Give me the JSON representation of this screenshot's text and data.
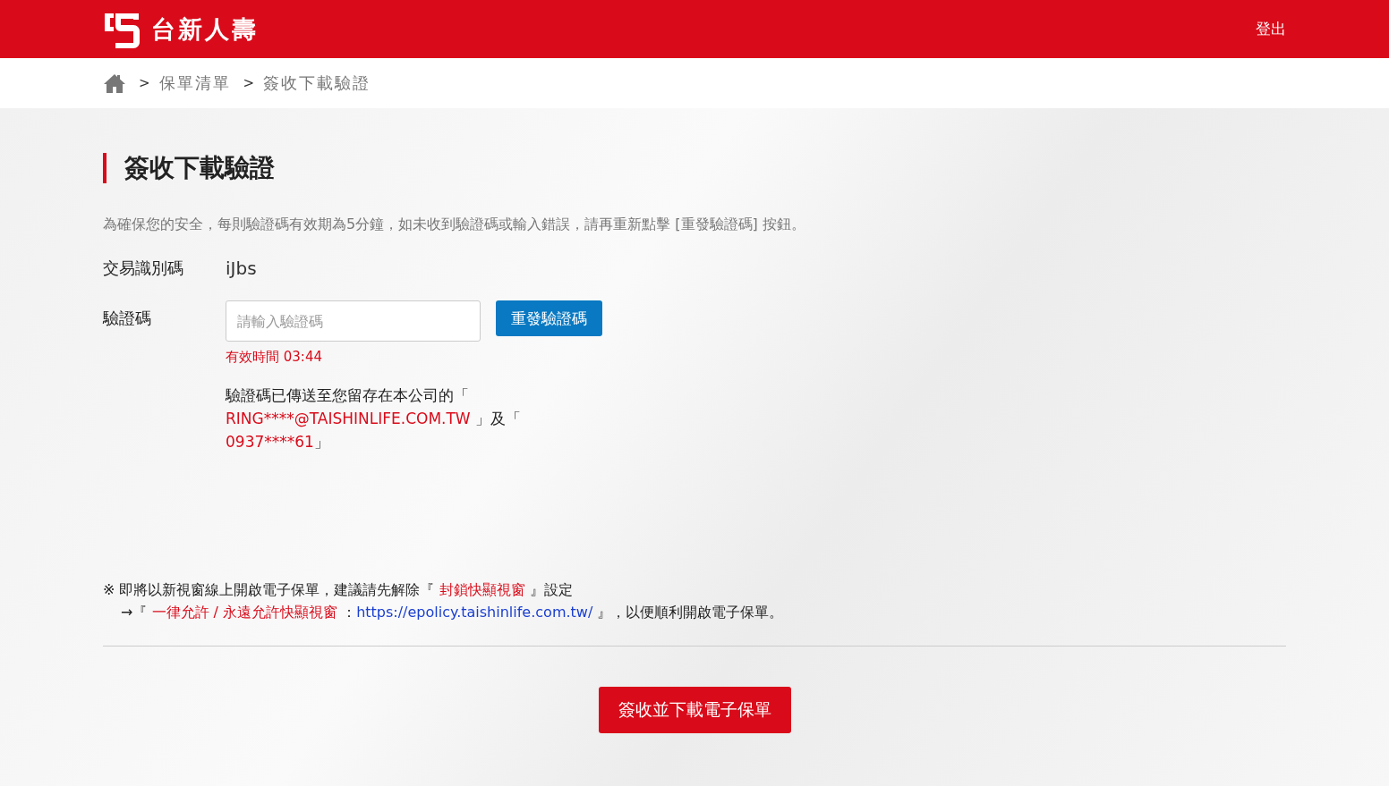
{
  "header": {
    "brand": "台新人壽",
    "logout": "登出"
  },
  "breadcrumb": [
    {
      "label": "保單清單",
      "separator": ">"
    },
    {
      "label": "簽收下載驗證",
      "separator": ">"
    }
  ],
  "page_title": "簽收下載驗證",
  "description": "為確保您的安全，每則驗證碼有效期為5分鐘，如未收到驗證碼或輸入錯誤，請再重新點擊 [重發驗證碼] 按鈕。",
  "transaction": {
    "label": "交易識別碼",
    "value": "iJbs"
  },
  "verification": {
    "label": "驗證碼",
    "placeholder": "請輸入驗證碼",
    "resend_button": "重發驗證碼",
    "expiry": "有效時間 03:44",
    "message": [
      {
        "text": "驗證碼已傳送至您留存在本公司的「 ",
        "kind": "plain"
      },
      {
        "text": "RING****@TAISHINLIFE.COM.TW",
        "kind": "highlight"
      },
      {
        "text": " 」及「 ",
        "kind": "plain"
      },
      {
        "text": "0937****61",
        "kind": "highlight"
      },
      {
        "text": "」",
        "kind": "plain"
      }
    ]
  },
  "notice": [
    [
      {
        "text": "※ 即將以新視窗線上開啟電子保單，建議請先解除『 ",
        "kind": "plain"
      },
      {
        "text": "封鎖快顯視窗",
        "kind": "highlight"
      },
      {
        "text": " 』設定",
        "kind": "plain"
      }
    ],
    [
      {
        "text": "→『 ",
        "kind": "plain"
      },
      {
        "text": "一律允許 / 永遠允許快顯視窗",
        "kind": "highlight"
      },
      {
        "text": " ：",
        "kind": "plain"
      },
      {
        "text": "https://epolicy.taishinlife.com.tw/",
        "kind": "link"
      },
      {
        "text": " 』，以便順利開啟電子保單。",
        "kind": "plain"
      }
    ]
  ],
  "submit_button": "簽收並下載電子保單"
}
